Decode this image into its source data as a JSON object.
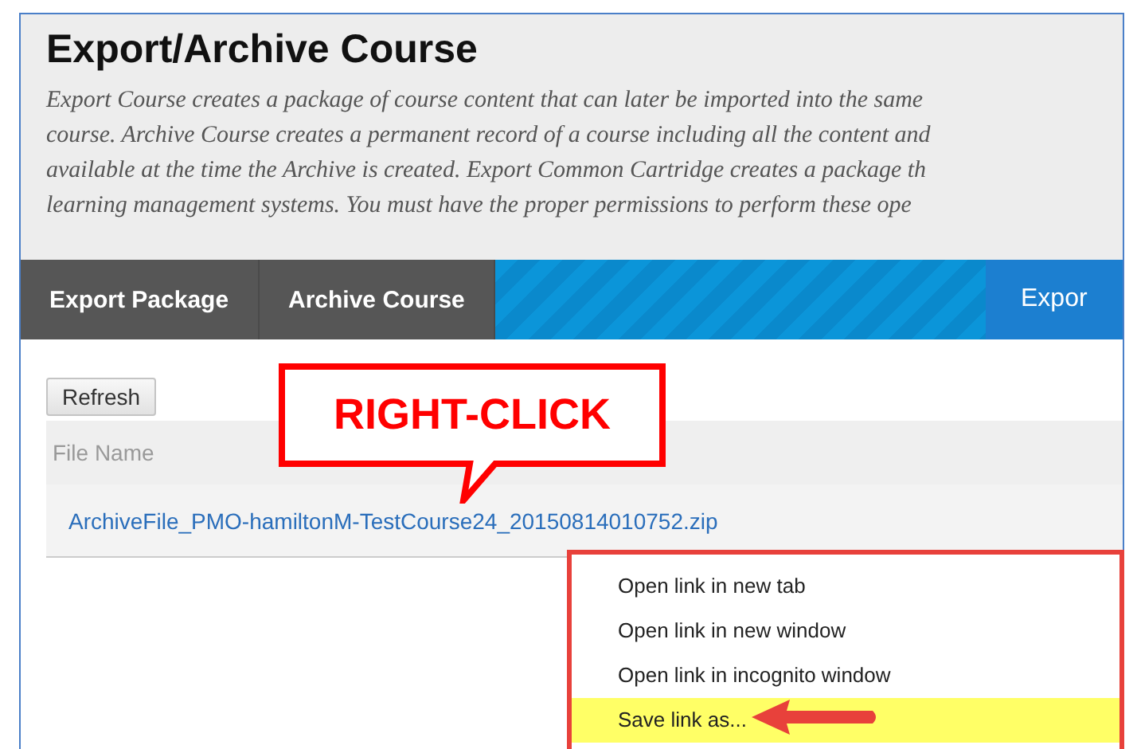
{
  "page": {
    "title": "Export/Archive Course",
    "description": [
      "Export Course creates a package of course content that can later be imported into the same",
      "course. Archive Course creates a permanent record of a course including all the content and",
      "available at the time the Archive is created. Export Common Cartridge creates a package th",
      "learning management systems. You must have the proper permissions to perform these ope"
    ]
  },
  "tabs": [
    {
      "label": "Export Package",
      "kind": "dark"
    },
    {
      "label": "Archive Course",
      "kind": "dark"
    },
    {
      "label": "Expor",
      "kind": "blue"
    }
  ],
  "refresh_button": "Refresh",
  "table": {
    "columns": [
      "File Name"
    ],
    "rows": [
      {
        "file": "ArchiveFile_PMO-hamiltonM-TestCourse24_20150814010752.zip"
      }
    ]
  },
  "callout": "RIGHT-CLICK",
  "context_menu": [
    {
      "label": "Open link in new tab",
      "selected": false
    },
    {
      "label": "Open link in new window",
      "selected": false
    },
    {
      "label": "Open link in incognito window",
      "selected": false
    },
    {
      "label": "Save link as...",
      "selected": true
    }
  ]
}
